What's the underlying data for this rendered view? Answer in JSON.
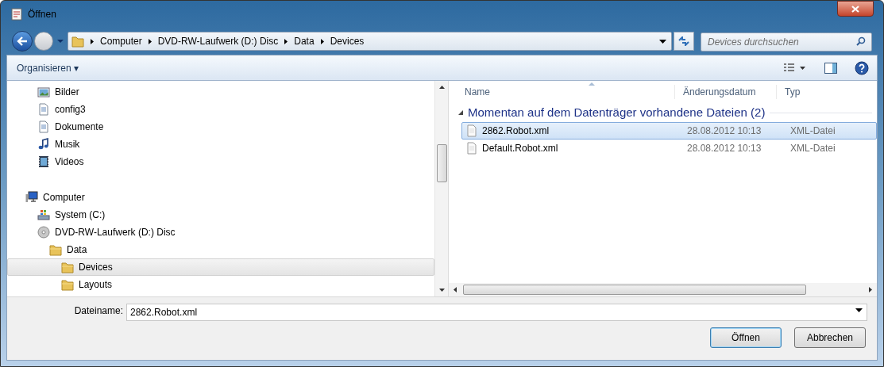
{
  "window": {
    "title": "Öffnen"
  },
  "address_bar": {
    "crumbs": [
      "Computer",
      "DVD-RW-Laufwerk (D:) Disc",
      "Data",
      "Devices"
    ]
  },
  "search": {
    "placeholder": "Devices durchsuchen"
  },
  "toolbar": {
    "organize": "Organisieren ▾"
  },
  "nav": {
    "items": [
      {
        "label": "Bilder",
        "kind": "pictures",
        "selected": false
      },
      {
        "label": "config3",
        "kind": "document",
        "selected": false
      },
      {
        "label": "Dokumente",
        "kind": "document",
        "selected": false
      },
      {
        "label": "Musik",
        "kind": "music",
        "selected": false
      },
      {
        "label": "Videos",
        "kind": "video",
        "selected": false
      }
    ],
    "tree": [
      {
        "label": "Computer",
        "kind": "computer",
        "selected": false,
        "children": [
          {
            "label": "System (C:)",
            "kind": "drive",
            "selected": false
          },
          {
            "label": "DVD-RW-Laufwerk (D:) Disc",
            "kind": "disc",
            "selected": false,
            "children": [
              {
                "label": "Data",
                "kind": "folder",
                "selected": false,
                "children": [
                  {
                    "label": "Devices",
                    "kind": "folder",
                    "selected": true
                  },
                  {
                    "label": "Layouts",
                    "kind": "folder",
                    "selected": false
                  }
                ]
              }
            ]
          }
        ]
      }
    ]
  },
  "file_list": {
    "columns": [
      "Name",
      "Änderungsdatum",
      "Typ"
    ],
    "group": {
      "title": "Momentan auf dem Datenträger vorhandene Dateien (2)",
      "expanded": true
    },
    "rows": [
      {
        "name": "2862.Robot.xml",
        "date": "28.08.2012 10:13",
        "type": "XML-Datei",
        "selected": true
      },
      {
        "name": "Default.Robot.xml",
        "date": "28.08.2012 10:13",
        "type": "XML-Datei",
        "selected": false
      }
    ]
  },
  "filename": {
    "label": "Dateiname:",
    "value": "2862.Robot.xml"
  },
  "buttons": [
    {
      "label": "Öffnen",
      "default": true
    },
    {
      "label": "Abbrechen",
      "default": false
    }
  ]
}
